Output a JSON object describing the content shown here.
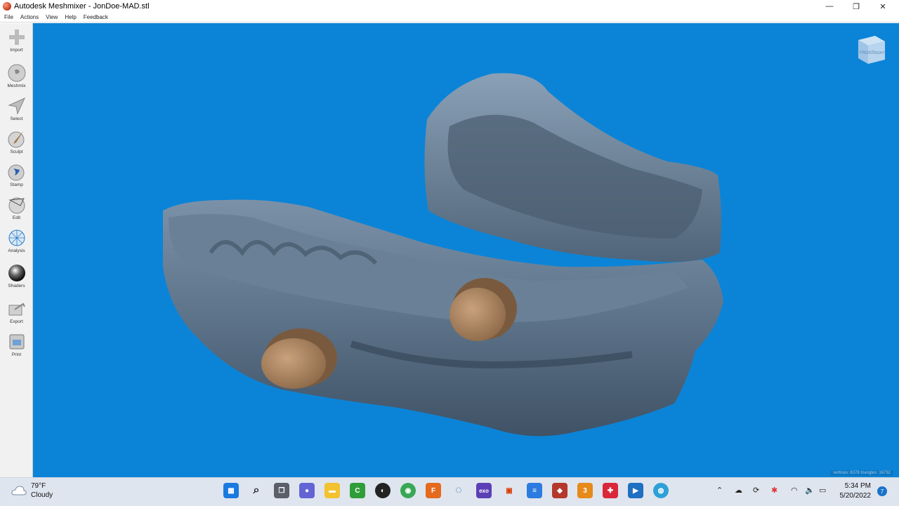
{
  "window": {
    "title": "Autodesk Meshmixer - JonDoe-MAD.stl",
    "minimize": "—",
    "maximize": "❐",
    "close": "✕"
  },
  "menu": [
    "File",
    "Actions",
    "View",
    "Help",
    "Feedback"
  ],
  "tools": [
    "Import",
    "Meshmix",
    "Select",
    "Sculpt",
    "Stamp",
    "Edit",
    "Analysis",
    "Shaders",
    "Export",
    "Print"
  ],
  "viewcube": {
    "front": "FRONT",
    "right": "RIGHT"
  },
  "status": "vertices: 8378 triangles: 16732",
  "colors": {
    "viewport": "#0b84d7",
    "mesh": "#5b7188",
    "attachment": "#a98360"
  },
  "taskbar": {
    "weather_temp": "79°F",
    "weather_cond": "Cloudy",
    "time": "5:34 PM",
    "date": "5/20/2022",
    "notifications": "7"
  }
}
